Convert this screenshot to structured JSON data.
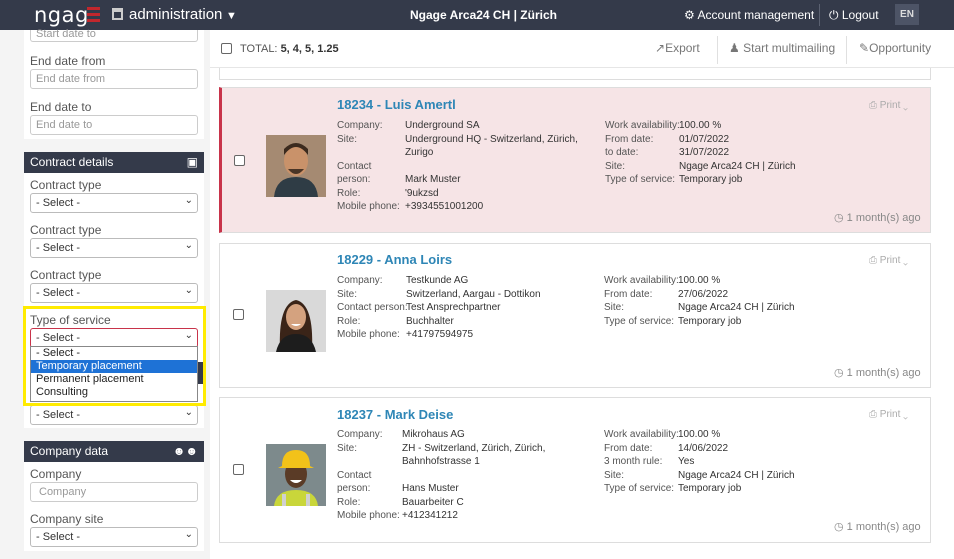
{
  "topbar": {
    "logo": "ngag",
    "app": "administration",
    "center": "Ngage Arca24 CH | Zürich",
    "account": "Account management",
    "logout": "Logout",
    "lang": "EN"
  },
  "sidebar": {
    "start_date_to_placeholder": "Start date to",
    "end_date_from_label": "End date from",
    "end_date_from_placeholder": "End date from",
    "end_date_to_label": "End date to",
    "end_date_to_placeholder": "End date to",
    "contract_header": "Contract details",
    "contract_type_label": "Contract type",
    "select_placeholder": "- Select -",
    "type_of_service_label": "Type of service",
    "dropdown_options": [
      "- Select -",
      "Temporary placement",
      "Permanent placement",
      "Consulting"
    ],
    "dropdown_highlighted": "Temporary placement",
    "company_header": "Company data",
    "company_label": "Company",
    "company_placeholder": "Company",
    "company_site_label": "Company site"
  },
  "toolbar": {
    "total_label": "TOTAL:",
    "total_values": "5, 4, 5, 1.25",
    "export": "Export",
    "multimailing": "Start multimailing",
    "opportunity": "Opportunity"
  },
  "cards": [
    {
      "title": "18234 - Luis Amertl",
      "company_k": "Company:",
      "company": "Underground SA",
      "site_k": "Site:",
      "site1": "Underground HQ - Switzerland, Zürich,",
      "site2": "Zurigo",
      "contact_k1": "Contact",
      "contact_k2": "person:",
      "contact": "Mark Muster",
      "role_k": "Role:",
      "role": "'9ukzsd",
      "mobile_k": "Mobile phone:",
      "mobile": "+3934551001200",
      "work_k": "Work availability:",
      "work": "100.00 %",
      "from_k": "From date:",
      "from": "01/07/2022",
      "to_k": "to date:",
      "to": "31/07/2022",
      "rsite_k": "Site:",
      "rsite": "Ngage Arca24 CH | Zürich",
      "tos_k": "Type of service:",
      "tos": "Temporary job",
      "print": "Print",
      "ago": "1 month(s) ago"
    },
    {
      "title": "18229 - Anna Loirs",
      "company_k": "Company:",
      "company": "Testkunde AG",
      "site_k": "Site:",
      "site1": "Switzerland, Aargau - Dottikon",
      "contact_k": "Contact person:",
      "contact": "Test Ansprechpartner",
      "role_k": "Role:",
      "role": "Buchhalter",
      "mobile_k": "Mobile phone:",
      "mobile": "+41797594975",
      "work_k": "Work availability:",
      "work": "100.00 %",
      "from_k": "From date:",
      "from": "27/06/2022",
      "rsite_k": "Site:",
      "rsite": "Ngage Arca24 CH | Zürich",
      "tos_k": "Type of service:",
      "tos": "Temporary job",
      "print": "Print",
      "ago": "1 month(s) ago"
    },
    {
      "title": "18237 - Mark Deise",
      "company_k": "Company:",
      "company": "Mikrohaus AG",
      "site_k": "Site:",
      "site1": "ZH - Switzerland, Zürich, Zürich,",
      "site2": "Bahnhofstrasse 1",
      "contact_k1": "Contact",
      "contact_k2": "person:",
      "contact": "Hans Muster",
      "role_k": "Role:",
      "role": "Bauarbeiter C",
      "mobile_k": "Mobile phone:",
      "mobile": "+412341212",
      "work_k": "Work availability:",
      "work": "100.00 %",
      "from_k": "From date:",
      "from": "14/06/2022",
      "rule_k": "3 month rule:",
      "rule": "Yes",
      "rsite_k": "Site:",
      "rsite": "Ngage Arca24 CH | Zürich",
      "tos_k": "Type of service:",
      "tos": "Temporary job",
      "print": "Print",
      "ago": "1 month(s) ago"
    }
  ],
  "colors": {
    "topbar": "#343a4a",
    "accent": "#2e86b6",
    "selected_card": "#f6e4e6",
    "highlight": "#ffeb00",
    "logo_mark": "#c2272d"
  }
}
